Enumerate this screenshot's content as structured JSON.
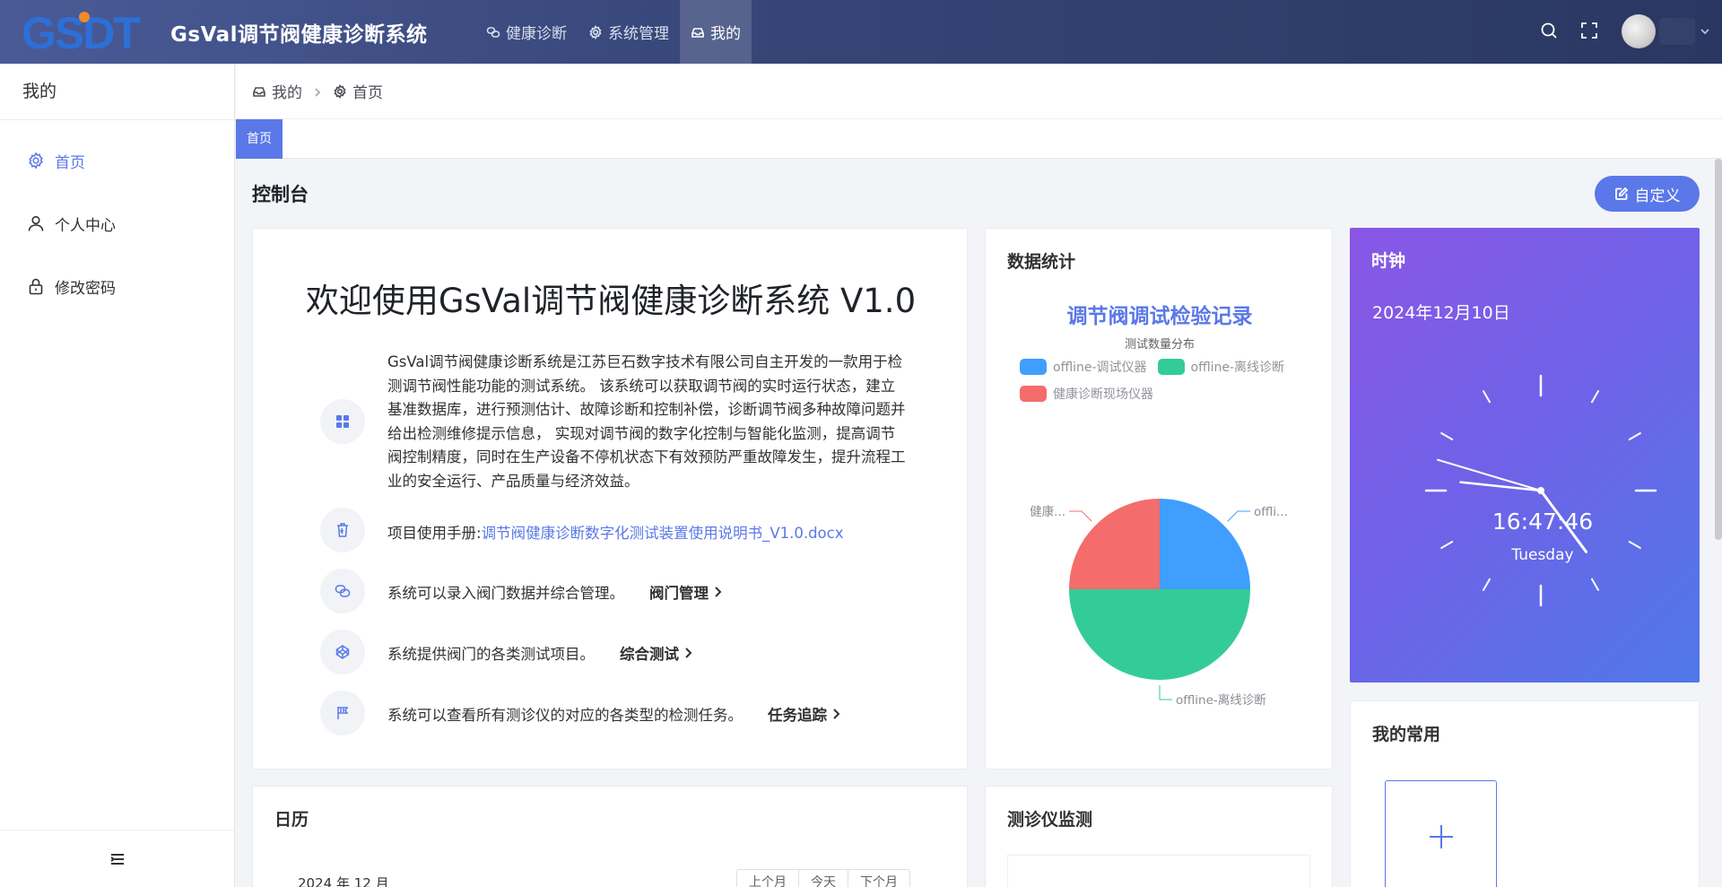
{
  "header": {
    "logo_text": "GSDT",
    "app_title": "GsVal调节阀健康诊断系统",
    "nav": [
      {
        "label": "健康诊断",
        "icon": "link-icon"
      },
      {
        "label": "系统管理",
        "icon": "gear-icon"
      },
      {
        "label": "我的",
        "icon": "inbox-icon",
        "active": true
      }
    ]
  },
  "sidebar": {
    "title": "我的",
    "items": [
      {
        "label": "首页",
        "icon": "gear-icon",
        "active": true
      },
      {
        "label": "个人中心",
        "icon": "user-icon"
      },
      {
        "label": "修改密码",
        "icon": "lock-icon"
      }
    ]
  },
  "breadcrumb": {
    "items": [
      "我的",
      "首页"
    ]
  },
  "tabs": [
    {
      "label": "首页",
      "active": true
    }
  ],
  "main": {
    "title": "控制台",
    "custom_button": "自定义"
  },
  "welcome": {
    "heading": "欢迎使用GsVal调节阀健康诊断系统 V1.0",
    "intro": "GsVal调节阀健康诊断系统是江苏巨石数字技术有限公司自主开发的一款用于检测调节阀性能功能的测试系统。 该系统可以获取调节阀的实时运行状态，建立基准数据库，进行预测估计、故障诊断和控制补偿，诊断调节阀多种故障问题并给出检测维修提示信息， 实现对调节阀的数字化控制与智能化监测，提高调节阀控制精度，同时在生产设备不停机状态下有效预防严重故障发生，提升流程工业的安全运行、产品质量与经济效益。",
    "manual_label": "项目使用手册: ",
    "manual_link": "调节阀健康诊断数字化测试装置使用说明书_V1.0.docx",
    "features": [
      {
        "text": "系统可以录入阀门数据并综合管理。",
        "action": "阀门管理"
      },
      {
        "text": "系统提供阀门的各类测试项目。",
        "action": "综合测试"
      },
      {
        "text": "系统可以查看所有测诊仪的对应的各类型的检测任务。",
        "action": "任务追踪"
      }
    ]
  },
  "stats": {
    "title": "数据统计",
    "colors": {
      "blue": "#409eff",
      "green": "#33cc99",
      "red": "#f56c6c"
    }
  },
  "chart_data": {
    "type": "pie",
    "title": "调节阀调试检验记录",
    "subtitle": "测试数量分布",
    "series": [
      {
        "name": "offline-调试仪器",
        "value": 1,
        "label": "offli...",
        "color": "#409eff"
      },
      {
        "name": "offline-离线诊断",
        "value": 2,
        "label": "offline-离线诊断",
        "color": "#33cc99"
      },
      {
        "name": "健康诊断现场仪器",
        "value": 1,
        "label": "健康...",
        "color": "#f56c6c"
      }
    ],
    "legend_position": "top"
  },
  "clock": {
    "title": "时钟",
    "date": "2024年12月10日",
    "time": "16:47:46",
    "weekday": "Tuesday"
  },
  "calendar": {
    "title": "日历",
    "month": "2024 年 12 月",
    "buttons": [
      "上个月",
      "今天",
      "下个月"
    ]
  },
  "monitor": {
    "title": "测诊仪监测"
  },
  "favorites": {
    "title": "我的常用"
  }
}
